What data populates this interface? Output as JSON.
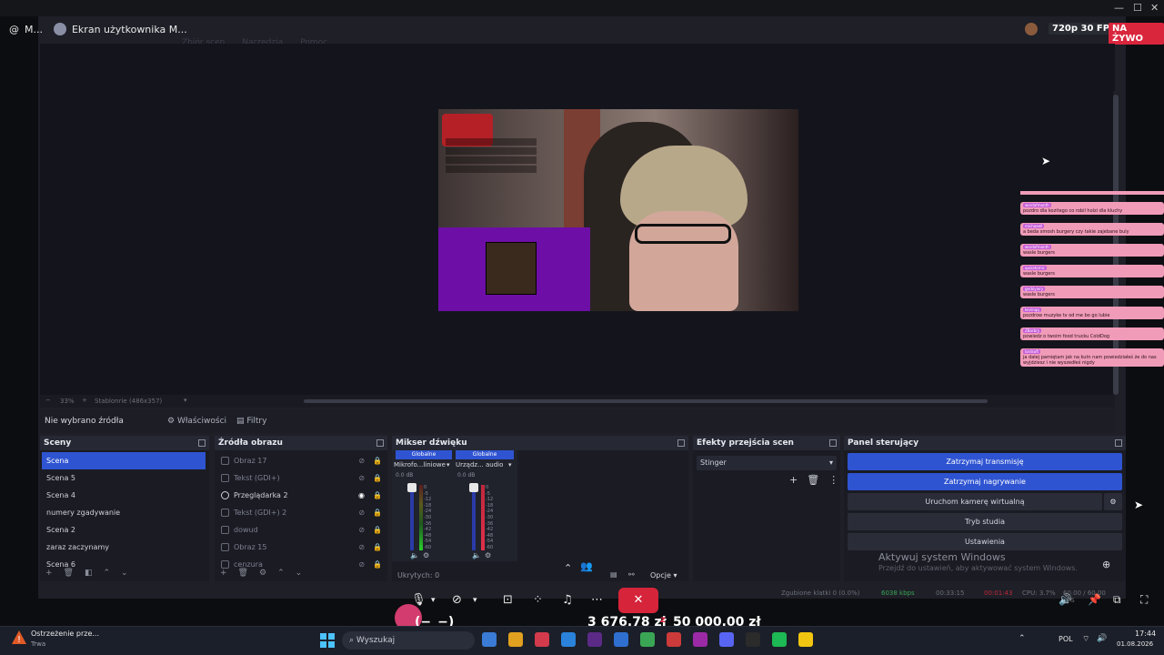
{
  "top": {
    "window_controls": [
      "—",
      "☐",
      "✕"
    ],
    "source_label": "M...",
    "screen_title": "Ekran użytkownika M...",
    "quality": "720p 30 FPS",
    "live_badge": "NA ŻYWO",
    "ghost_menu": [
      "Zbiór scen",
      "Narzędzia",
      "Pomoc"
    ]
  },
  "preview": {
    "status_left": "33%",
    "status_mid": "Stablonrie (486x357)"
  },
  "source_bar": {
    "no_source": "Nie wybrano źródła",
    "properties": "Właściwości",
    "filters": "Filtry"
  },
  "scenes": {
    "title": "Sceny",
    "items": [
      "Scena",
      "Scena 5",
      "Scena 4",
      "numery zgadywanie",
      "Scena 2",
      "zaraz zaczynamy",
      "Scena 6"
    ]
  },
  "sources": {
    "title": "Źródła obrazu",
    "items": [
      "Obraz 17",
      "Tekst (GDI+)",
      "Przeglądarka 2",
      "Tekst (GDI+) 2",
      "dowud",
      "Obraz 15",
      "cenzura"
    ]
  },
  "mixer": {
    "title": "Mikser dźwięku",
    "ch1_tag": "Globalne",
    "ch1_name": "Mikrofo...liniowe",
    "ch1_db": "0.0 dB",
    "ch2_tag": "Globalne",
    "ch2_name": "Urządz... audio",
    "ch2_db": "0.0 dB",
    "scale": [
      "0",
      "-5",
      "-12",
      "-18",
      "-24",
      "-30",
      "-36",
      "-42",
      "-48",
      "-54",
      "-60"
    ],
    "hidden": "Ukrytych: 0",
    "options": "Opcje"
  },
  "transitions": {
    "title": "Efekty przejścia scen",
    "selected": "Stinger"
  },
  "controls": {
    "title": "Panel sterujący",
    "stop_stream": "Zatrzymaj transmisję",
    "stop_record": "Zatrzymaj nagrywanie",
    "virtual_cam": "Uruchom kamerę wirtualną",
    "studio": "Tryb studia",
    "settings": "Ustawienia"
  },
  "activation": {
    "title": "Aktywuj system Windows",
    "sub": "Przejdź do ustawień, aby aktywować system Windows."
  },
  "obs_status": {
    "dropped": "Zgubione klatki 0 (0.0%)",
    "kbps": "6038 kbps",
    "time1": "00:33:15",
    "time2": "00:01:43",
    "cpu": "CPU: 3.7%",
    "fps": "60.00 / 60.00 FPS"
  },
  "chat": [
    {
      "name": "wordofmonth",
      "msg": "pozdro dla kozitego co robil holzi dla kluchy"
    },
    {
      "name": "michaeell",
      "msg": "a beda smosh burgery czy takie zajebane buly"
    },
    {
      "name": "wordofmonth",
      "msg": "wasle burgers"
    },
    {
      "name": "quizatomic",
      "msg": "wasle burgers"
    },
    {
      "name": "gerblyiery",
      "msg": "wasle burgers"
    },
    {
      "name": "kevinqq",
      "msg": "pozdrow muzyke tv od me bo go lubie"
    },
    {
      "name": "ZBarbry",
      "msg": "powiedz o twoim food trucku ColdDog"
    },
    {
      "name": "lordsoft",
      "msg": "ja dalej pamiętam jak na kutn nam powiedziałeś że do nas wyjdziesz i nie wyszedłeś nigdy"
    }
  ],
  "call": {
    "emote": "(−_−)",
    "donation_current": "3 676,78 zł",
    "donation_sep": "z",
    "donation_goal": "50 000,00 zł"
  },
  "taskbar": {
    "notif_title": "Ostrzeżenie prze...",
    "notif_sub": "Trwa",
    "search_placeholder": "Wyszukaj",
    "lang": "POL",
    "time": "17:44",
    "date": "01.08.2026",
    "colors": [
      "#3a7bd5",
      "#e0a020",
      "#d13b4c",
      "#2a82da",
      "#5b2a86",
      "#2f6fd0",
      "#3aa655",
      "#cc3a3a",
      "#9c2aa6",
      "#5865f2",
      "#2b2b2b",
      "#1db954",
      "#f2c511"
    ]
  },
  "colors": {
    "accent": "#2f54d2",
    "live": "#d9263d",
    "chat_bg": "#f09bb8",
    "canvas_purple": "#6d0fa6"
  }
}
